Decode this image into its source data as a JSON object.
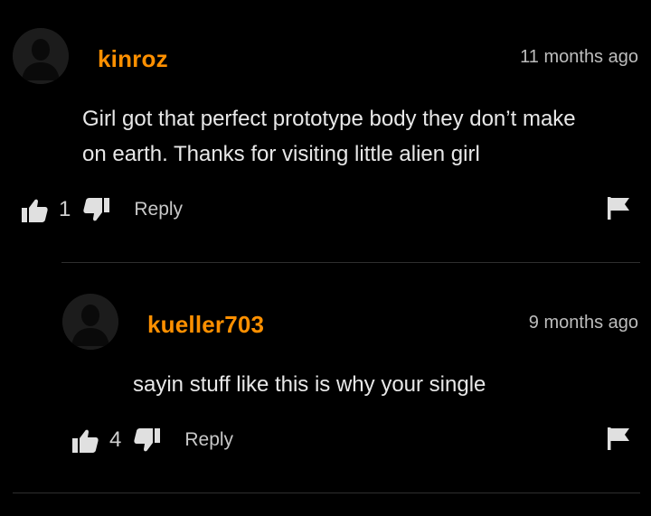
{
  "comments": [
    {
      "username": "kinroz",
      "timestamp": "11 months ago",
      "text_lines": [
        "Girl got that perfect prototype body they don’t make",
        "on earth. Thanks for visiting little alien girl"
      ],
      "likes": "1",
      "reply_label": "Reply"
    },
    {
      "username": "kueller703",
      "timestamp": "9 months ago",
      "text_lines": [
        "sayin stuff like this is why your single"
      ],
      "likes": "4",
      "reply_label": "Reply"
    }
  ],
  "colors": {
    "background": "#000000",
    "username": "#ff9000",
    "text": "#e8e8e8",
    "muted": "#bdbdbd",
    "divider": "#2e2e2e"
  },
  "icons": {
    "avatar": "default-avatar-icon",
    "like": "thumbs-up-icon",
    "dislike": "thumbs-down-icon",
    "report": "flag-icon"
  }
}
